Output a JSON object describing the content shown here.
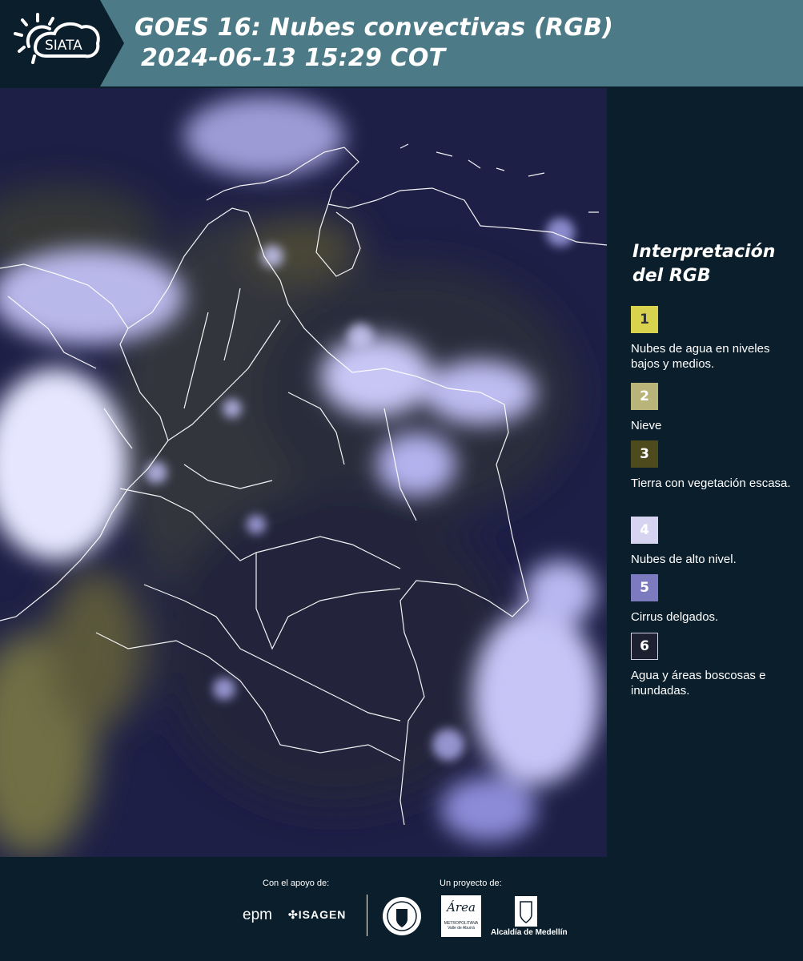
{
  "header": {
    "logo_text": "SIATA",
    "title_line1": "GOES 16: Nubes convectivas (RGB)",
    "title_line2": "2024-06-13 15:29 COT"
  },
  "legend": {
    "title": "Interpretación del RGB",
    "items": [
      {
        "number": "1",
        "label": "Nubes de agua en niveles bajos y medios.",
        "color": "#d8d24e",
        "text_color": "#333333"
      },
      {
        "number": "2",
        "label": "Nieve",
        "color": "#b9b57a",
        "text_color": "#ffffff"
      },
      {
        "number": "3",
        "label": "Tierra con vegetación escasa.",
        "color": "#4d4a1d",
        "text_color": "#ffffff"
      },
      {
        "number": "4",
        "label": "Nubes de alto nivel.",
        "color": "#d6d4f1",
        "text_color": "#ffffff"
      },
      {
        "number": "5",
        "label": "Cirrus delgados.",
        "color": "#7c7bbf",
        "text_color": "#ffffff"
      },
      {
        "number": "6",
        "label": "Agua y áreas boscosas e inundadas.",
        "color": "#1c2031",
        "text_color": "#ffffff"
      }
    ]
  },
  "footer": {
    "support_label": "Con el apoyo de:",
    "project_label": "Un proyecto de:",
    "sponsors": [
      "epm",
      "ISAGEN"
    ],
    "partners": [
      "Área Metropolitana Valle de Aburrá",
      "Alcaldía de Medellín"
    ],
    "area_text": "Área",
    "area_sub1": "METROPOLITANA",
    "area_sub2": "Valle de Aburrá",
    "alcaldia_text": "Alcaldía de Medellín"
  }
}
